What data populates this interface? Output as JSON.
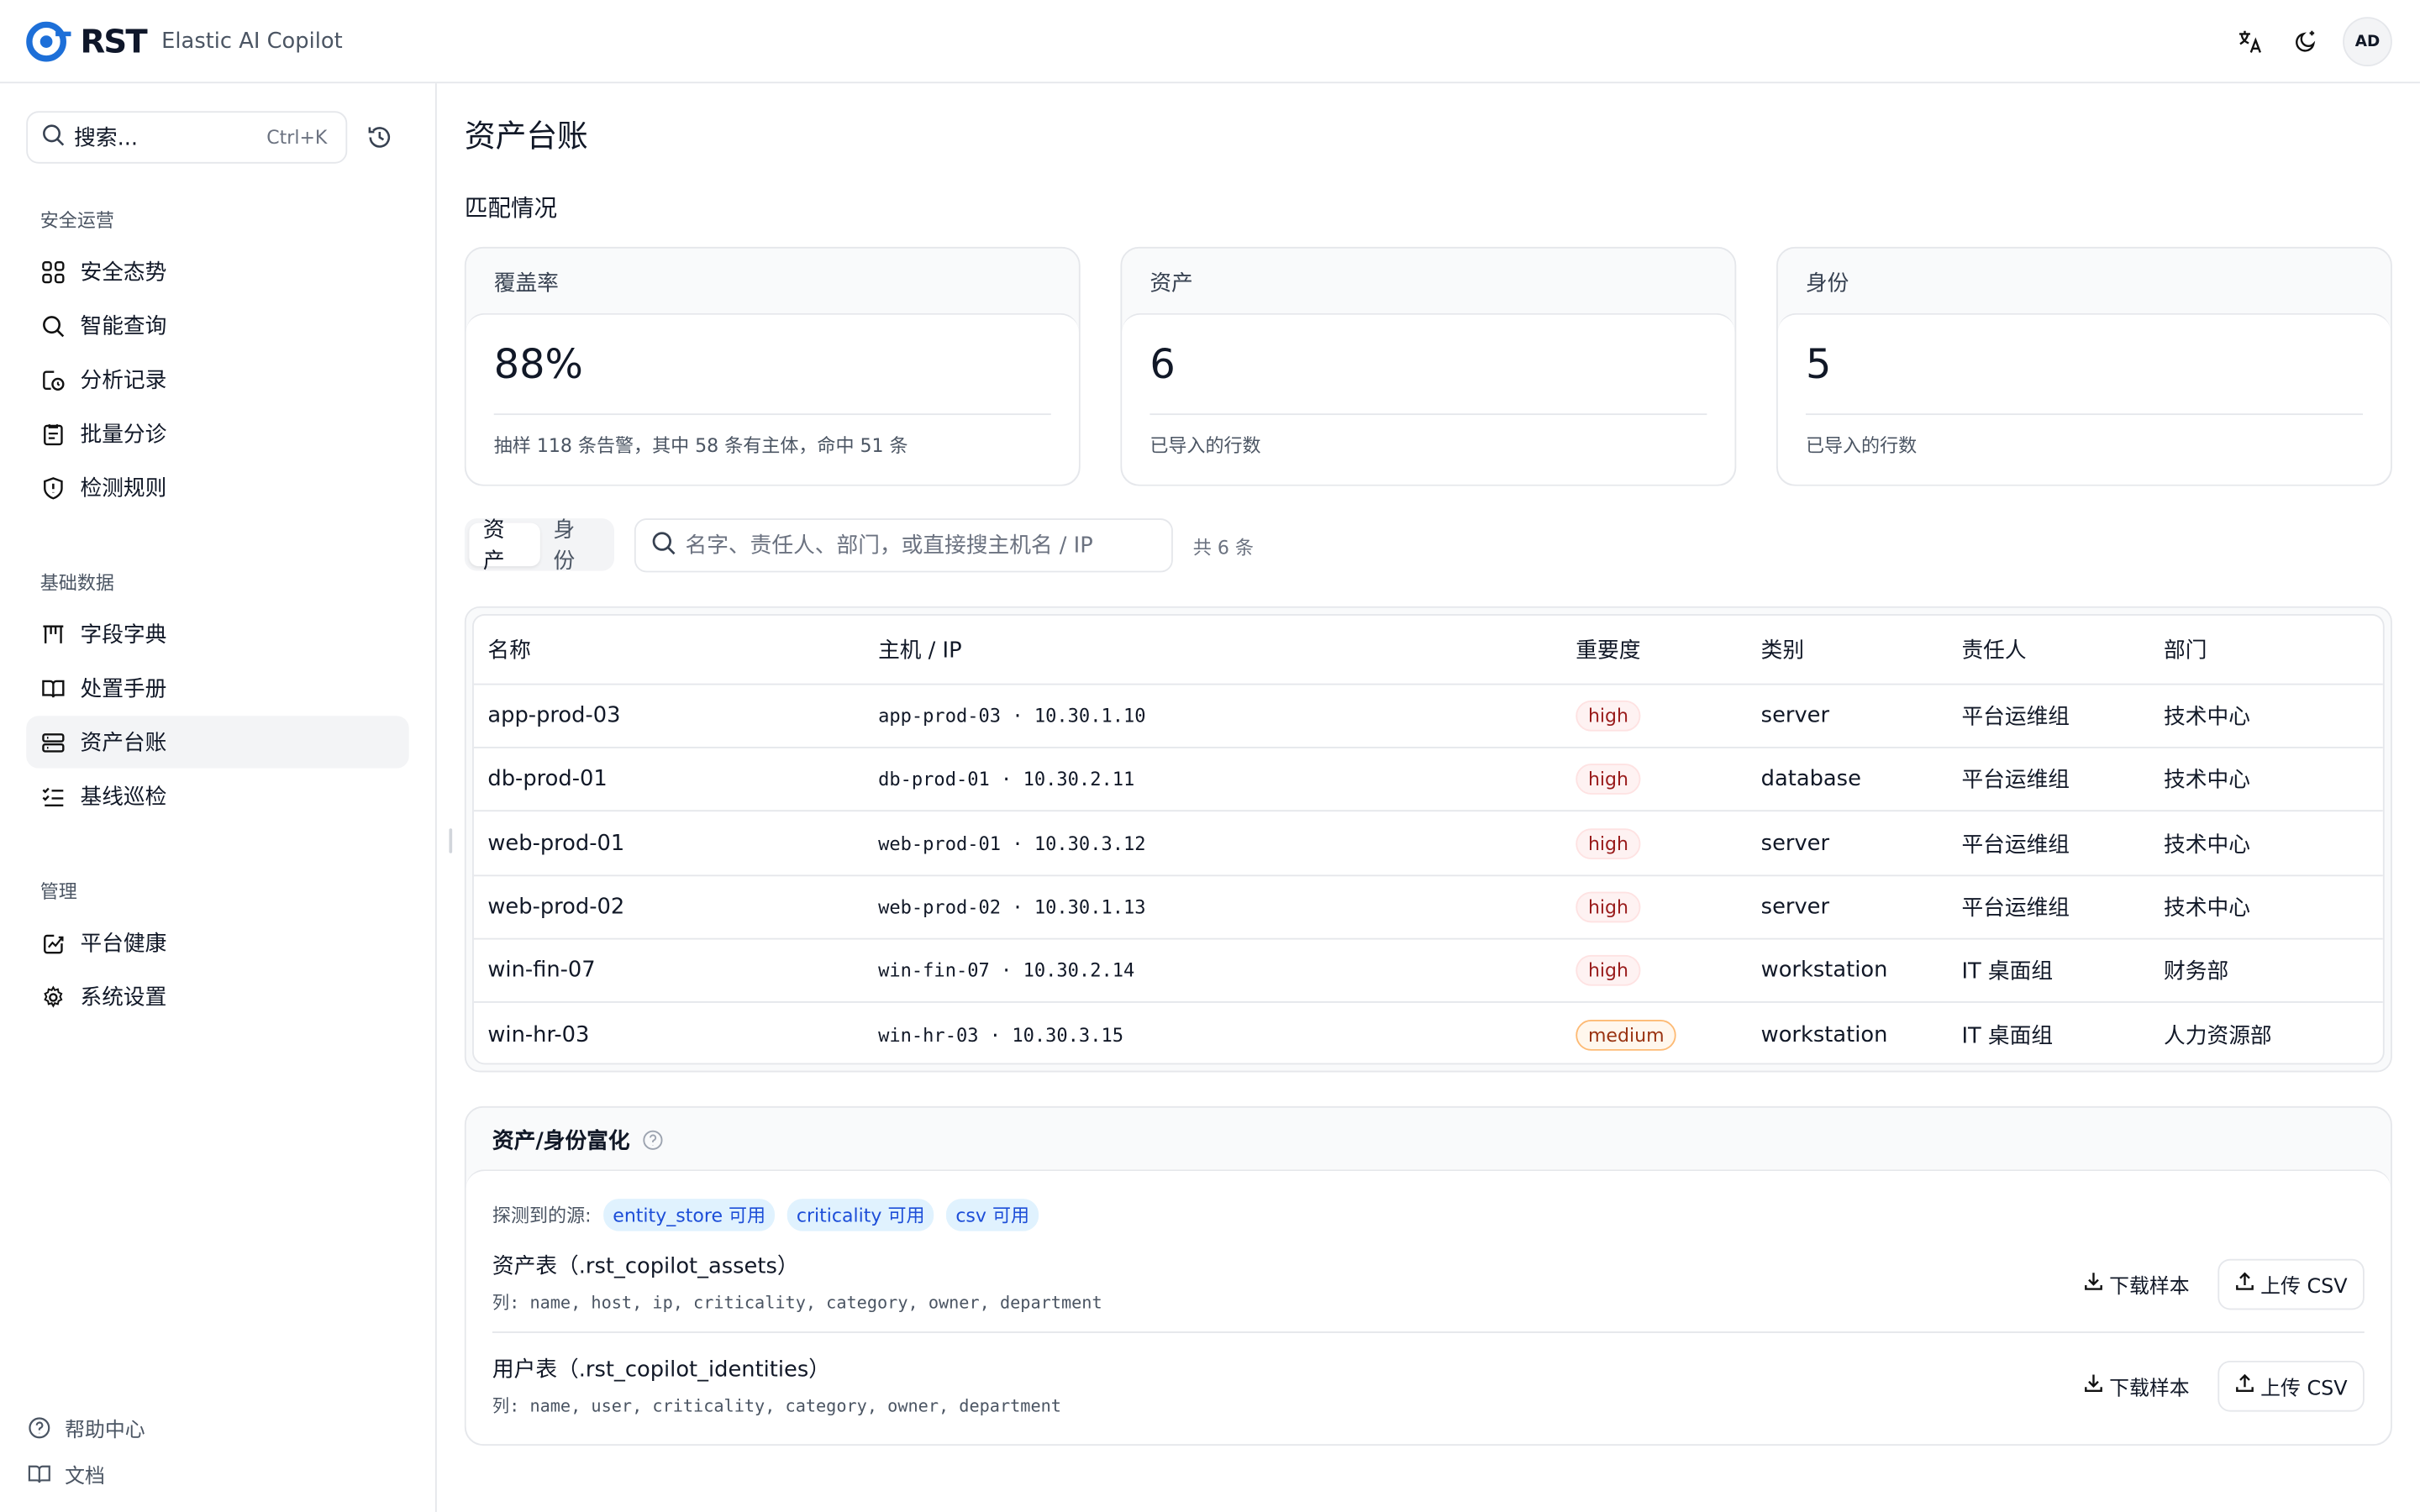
{
  "header": {
    "logo_text": "RST",
    "app_name": "Elastic AI Copilot",
    "avatar": "AD",
    "icons": [
      "translate-icon",
      "theme-toggle-icon"
    ]
  },
  "sidebar": {
    "search_placeholder": "搜索...",
    "search_shortcut": "Ctrl+K",
    "sections": [
      {
        "label": "安全运营",
        "items": [
          {
            "label": "安全态势",
            "icon": "dashboard-icon"
          },
          {
            "label": "智能查询",
            "icon": "search-icon"
          },
          {
            "label": "分析记录",
            "icon": "history-icon"
          },
          {
            "label": "批量分诊",
            "icon": "clipboard-icon"
          },
          {
            "label": "检测规则",
            "icon": "shield-icon"
          }
        ]
      },
      {
        "label": "基础数据",
        "items": [
          {
            "label": "字段字典",
            "icon": "field-dictionary-icon"
          },
          {
            "label": "处置手册",
            "icon": "book-icon"
          },
          {
            "label": "资产台账",
            "icon": "server-icon",
            "active": true
          },
          {
            "label": "基线巡检",
            "icon": "checklist-icon"
          }
        ]
      },
      {
        "label": "管理",
        "items": [
          {
            "label": "平台健康",
            "icon": "health-icon"
          },
          {
            "label": "系统设置",
            "icon": "gear-icon"
          }
        ]
      }
    ],
    "footer": [
      {
        "label": "帮助中心",
        "icon": "help-icon"
      },
      {
        "label": "文档",
        "icon": "docs-icon"
      }
    ]
  },
  "main": {
    "title": "资产台账",
    "section_title": "匹配情况",
    "stats": [
      {
        "label": "覆盖率",
        "value": "88%",
        "sub": "抽样 118 条告警，其中 58 条有主体，命中 51 条"
      },
      {
        "label": "资产",
        "value": "6",
        "sub": "已导入的行数"
      },
      {
        "label": "身份",
        "value": "5",
        "sub": "已导入的行数"
      }
    ],
    "tabs": [
      "资产",
      "身份"
    ],
    "active_tab": 0,
    "filter_placeholder": "名字、责任人、部门，或直接搜主机名 / IP",
    "count_text": "共 6 条",
    "table": {
      "columns": [
        "名称",
        "主机 / IP",
        "重要度",
        "类别",
        "责任人",
        "部门"
      ],
      "rows": [
        {
          "name": "app-prod-03",
          "host": "app-prod-03 · 10.30.1.10",
          "criticality": "high",
          "category": "server",
          "owner": "平台运维组",
          "department": "技术中心"
        },
        {
          "name": "db-prod-01",
          "host": "db-prod-01 · 10.30.2.11",
          "criticality": "high",
          "category": "database",
          "owner": "平台运维组",
          "department": "技术中心"
        },
        {
          "name": "web-prod-01",
          "host": "web-prod-01 · 10.30.3.12",
          "criticality": "high",
          "category": "server",
          "owner": "平台运维组",
          "department": "技术中心"
        },
        {
          "name": "web-prod-02",
          "host": "web-prod-02 · 10.30.1.13",
          "criticality": "high",
          "category": "server",
          "owner": "平台运维组",
          "department": "技术中心"
        },
        {
          "name": "win-fin-07",
          "host": "win-fin-07 · 10.30.2.14",
          "criticality": "high",
          "category": "workstation",
          "owner": "IT 桌面组",
          "department": "财务部"
        },
        {
          "name": "win-hr-03",
          "host": "win-hr-03 · 10.30.3.15",
          "criticality": "medium",
          "category": "workstation",
          "owner": "IT 桌面组",
          "department": "人力资源部"
        }
      ]
    },
    "enrichment": {
      "title": "资产/身份富化",
      "detected_label": "探测到的源:",
      "sources": [
        "entity_store 可用",
        "criticality 可用",
        "csv 可用"
      ],
      "tables": [
        {
          "name": "资产表（.rst_copilot_assets）",
          "cols": "列: name, host, ip, criticality, category, owner, department",
          "download": "下载样本",
          "upload": "上传 CSV"
        },
        {
          "name": "用户表（.rst_copilot_identities）",
          "cols": "列: name, user, criticality, category, owner, department",
          "download": "下载样本",
          "upload": "上传 CSV"
        }
      ]
    }
  }
}
